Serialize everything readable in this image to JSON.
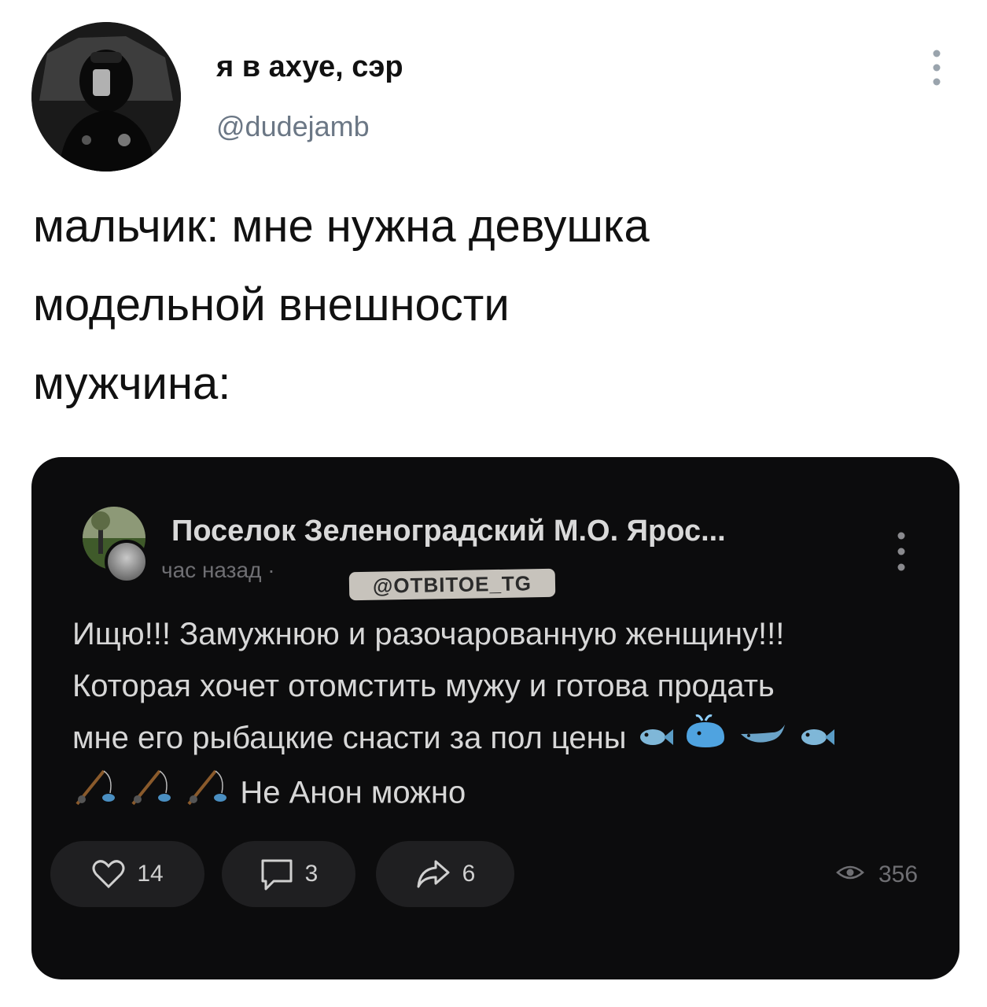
{
  "tweet": {
    "display_name": "я в ахуе, сэр",
    "handle": "@dudejamb",
    "text_lines": [
      "мальчик: мне нужна девушка",
      "модельной внешности",
      "мужчина:"
    ]
  },
  "embedded_post": {
    "group_name": "Поселок Зеленоградский М.О. Ярос...",
    "time": "час назад ·",
    "watermark": "@OTBITOE_TG",
    "text_lines": [
      "Ищю!!! Замужнюю и разочарованную женщину!!!",
      "Которая хочет отомстить мужу и готова продать",
      "мне его рыбацкие снасти за пол цены",
      "Не Анон можно"
    ],
    "emoji_line3": [
      "fish-emoji",
      "whale-emoji",
      "whale-2-emoji",
      "fish-emoji"
    ],
    "emoji_line4": [
      "fishing-pole-emoji",
      "fishing-pole-emoji",
      "fishing-pole-emoji"
    ],
    "likes": "14",
    "comments": "3",
    "shares": "6",
    "views": "356"
  },
  "colors": {
    "card_bg": "#0c0c0d",
    "action_bg": "#1f1f21",
    "handle_gray": "#6b7785"
  }
}
